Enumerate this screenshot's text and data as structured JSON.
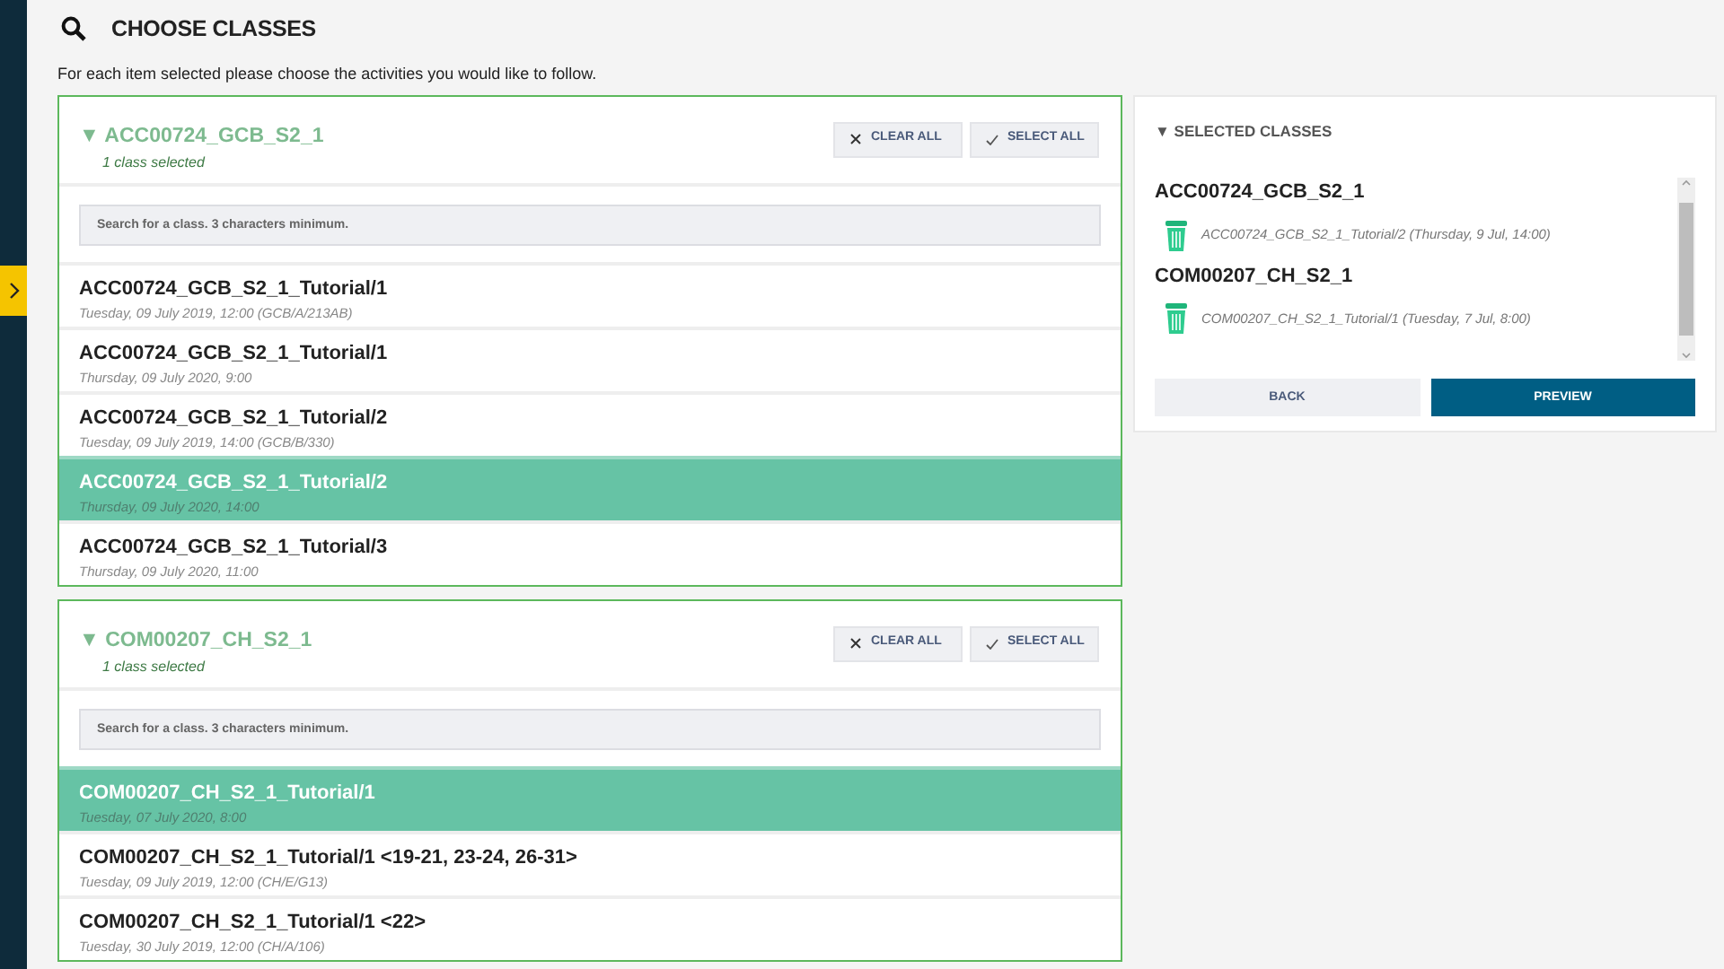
{
  "page": {
    "title": "CHOOSE CLASSES",
    "instruction": "For each item selected please choose the activities you would like to follow."
  },
  "groups": [
    {
      "toggle": "▼",
      "code": "ACC00724_GCB_S2_1",
      "summary": "1 class selected",
      "clear_label": "CLEAR ALL",
      "select_label": "SELECT ALL",
      "search_placeholder": "Search for a class. 3 characters minimum.",
      "classes": [
        {
          "name": "ACC00724_GCB_S2_1_Tutorial/1",
          "when": "Tuesday, 09 July 2019, 12:00 (GCB/A/213AB)",
          "selected": false
        },
        {
          "name": "ACC00724_GCB_S2_1_Tutorial/1",
          "when": "Thursday, 09 July 2020, 9:00",
          "selected": false
        },
        {
          "name": "ACC00724_GCB_S2_1_Tutorial/2",
          "when": "Tuesday, 09 July 2019, 14:00 (GCB/B/330)",
          "selected": false
        },
        {
          "name": "ACC00724_GCB_S2_1_Tutorial/2",
          "when": "Thursday, 09 July 2020, 14:00",
          "selected": true
        },
        {
          "name": "ACC00724_GCB_S2_1_Tutorial/3",
          "when": "Thursday, 09 July 2020, 11:00",
          "selected": false
        }
      ]
    },
    {
      "toggle": "▼",
      "code": "COM00207_CH_S2_1",
      "summary": "1 class selected",
      "clear_label": "CLEAR ALL",
      "select_label": "SELECT ALL",
      "search_placeholder": "Search for a class. 3 characters minimum.",
      "classes": [
        {
          "name": "COM00207_CH_S2_1_Tutorial/1",
          "when": "Tuesday, 07 July 2020, 8:00",
          "selected": true
        },
        {
          "name": "COM00207_CH_S2_1_Tutorial/1 <19-21, 23-24, 26-31>",
          "when": "Tuesday, 09 July 2019, 12:00 (CH/E/G13)",
          "selected": false
        },
        {
          "name": "COM00207_CH_S2_1_Tutorial/1 <22>",
          "when": "Tuesday, 30 July 2019, 12:00 (CH/A/106)",
          "selected": false
        }
      ]
    }
  ],
  "selected_panel": {
    "toggle": "▼",
    "title": "SELECTED CLASSES",
    "entries": [
      {
        "code": "ACC00724_GCB_S2_1",
        "items": [
          "ACC00724_GCB_S2_1_Tutorial/2 (Thursday, 9 Jul, 14:00)"
        ]
      },
      {
        "code": "COM00207_CH_S2_1",
        "items": [
          "COM00207_CH_S2_1_Tutorial/1 (Tuesday, 7 Jul, 8:00)"
        ]
      }
    ],
    "back_label": "BACK",
    "preview_label": "PREVIEW"
  }
}
